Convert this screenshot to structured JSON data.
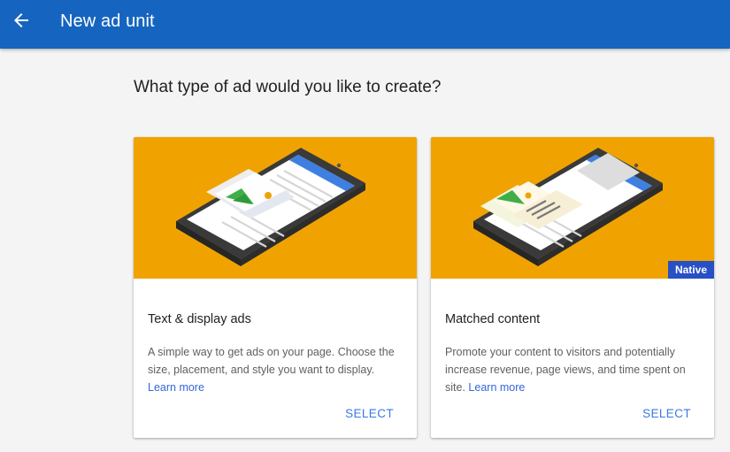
{
  "appbar": {
    "back_icon": "arrow-back-icon",
    "title": "New ad unit"
  },
  "page": {
    "heading": "What type of ad would you like to create?"
  },
  "cards": [
    {
      "title": "Text & display ads",
      "description": "A simple way to get ads on your page. Choose the size, placement, and style you want to display.",
      "learn_more": "Learn more",
      "select_label": "SELECT",
      "illustration": "phone-display-ad-illustration"
    },
    {
      "title": "Matched content",
      "description": "Promote your content to visitors and potentially increase revenue, page views, and time spent on site.",
      "learn_more": "Learn more",
      "select_label": "SELECT",
      "badge": "Native",
      "illustration": "phone-matched-content-illustration"
    }
  ],
  "colors": {
    "appbar": "#1565c0",
    "background": "#f4f4f4",
    "hero": "#f0a300",
    "link": "#3367d6",
    "select": "#3b78e7",
    "badge": "#2750c4"
  }
}
